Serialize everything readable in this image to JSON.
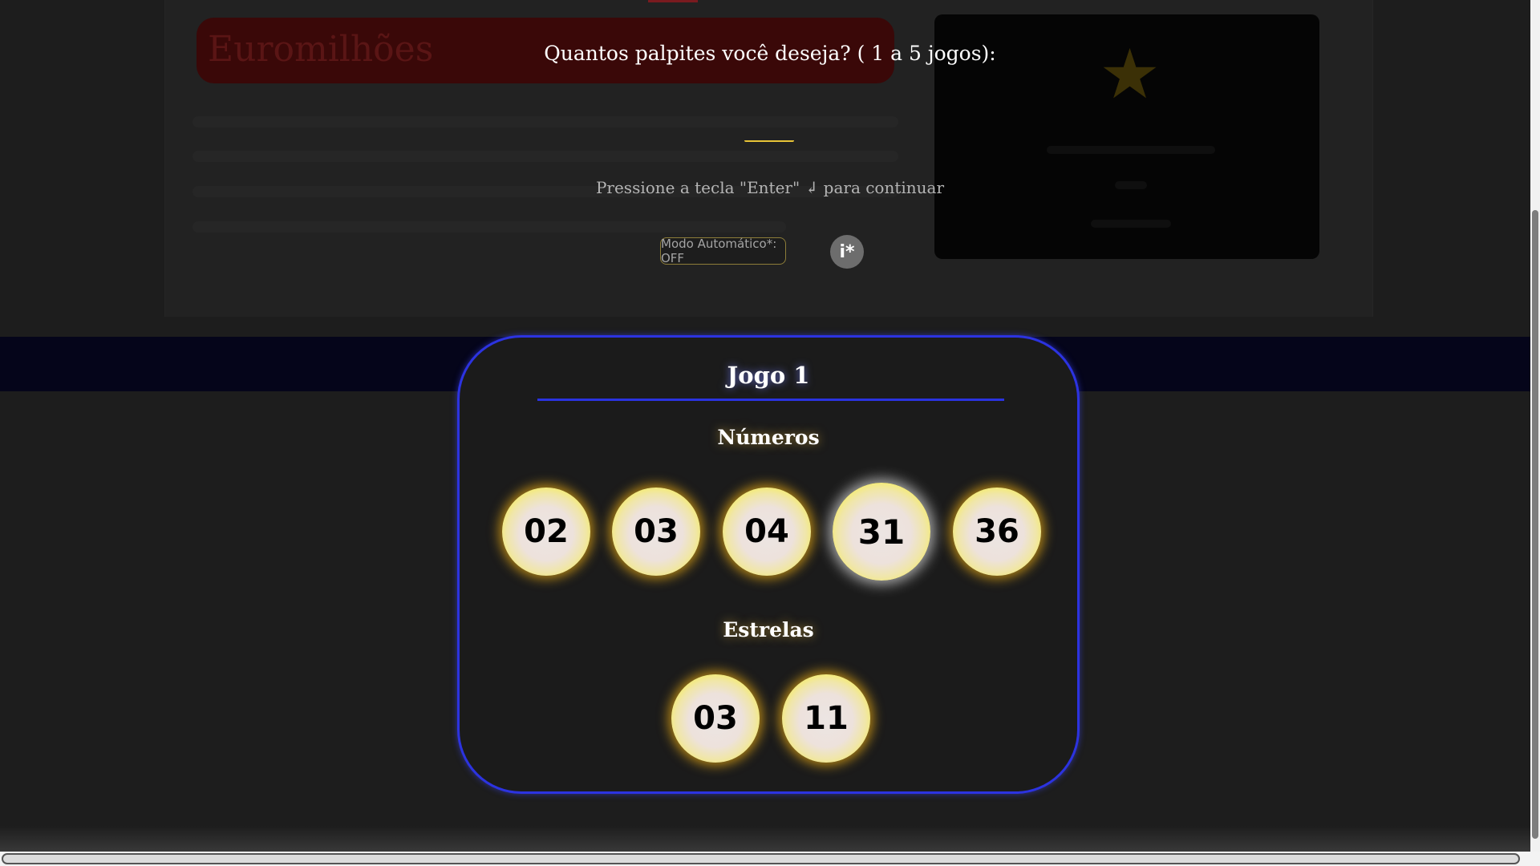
{
  "background": {
    "article_title": "Euromilhões"
  },
  "prompt": {
    "question": "Quantos palpites você deseja? ( 1 a 5 jogos):",
    "input_value": "",
    "hint": "Pressione a tecla \"Enter\" ↲ para continuar",
    "auto_mode_label": "Modo Automático*: OFF",
    "info_label": "i*"
  },
  "game": {
    "title": "Jogo 1",
    "numbers_label": "Números",
    "numbers": [
      "02",
      "03",
      "04",
      "31",
      "36"
    ],
    "stars_label": "Estrelas",
    "stars": [
      "03",
      "11"
    ]
  },
  "colors": {
    "card_border": "#2c33e0",
    "ball_yellow": "#f7ee5a",
    "background": "#1d1d1d"
  }
}
